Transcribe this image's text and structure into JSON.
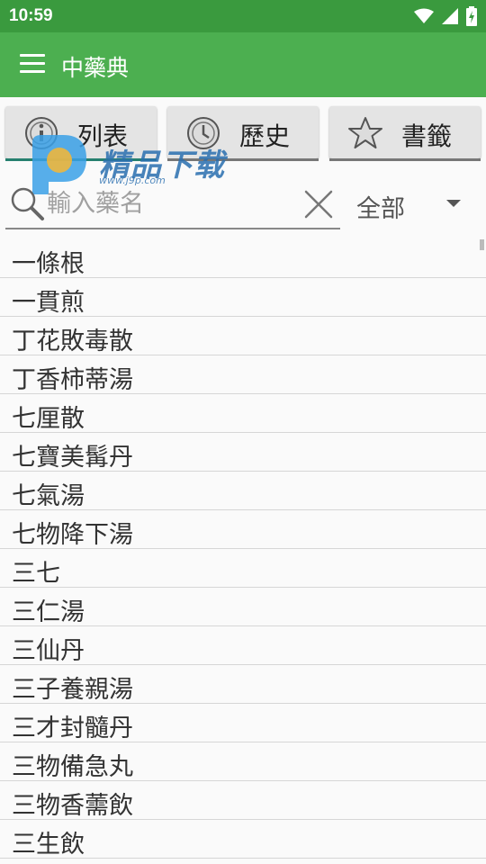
{
  "status_bar": {
    "time": "10:59",
    "icons": [
      "wifi-icon",
      "signal-icon",
      "battery-charging-icon"
    ]
  },
  "app_bar": {
    "title": "中藥典",
    "menu_icon": "hamburger-menu-icon"
  },
  "tabs": [
    {
      "label": "列表",
      "icon": "info-icon",
      "active": true
    },
    {
      "label": "歷史",
      "icon": "clock-icon",
      "active": false
    },
    {
      "label": "書籤",
      "icon": "star-icon",
      "active": false
    }
  ],
  "watermark": {
    "text": "精品下载",
    "url": "www.j9p.com"
  },
  "search": {
    "placeholder": "輸入藥名",
    "value": "",
    "scope": "全部"
  },
  "list": {
    "items": [
      "一條根",
      "一貫煎",
      "丁花敗毒散",
      "丁香柿蒂湯",
      "七厘散",
      "七寶美髯丹",
      "七氣湯",
      "七物降下湯",
      "三七",
      "三仁湯",
      "三仙丹",
      "三子養親湯",
      "三才封髓丹",
      "三物備急丸",
      "三物香薷飲",
      "三生飲"
    ]
  },
  "colors": {
    "status_bar": "#3a9a3e",
    "app_bar": "#4caf50",
    "tab_active_underline": "#26806f"
  }
}
